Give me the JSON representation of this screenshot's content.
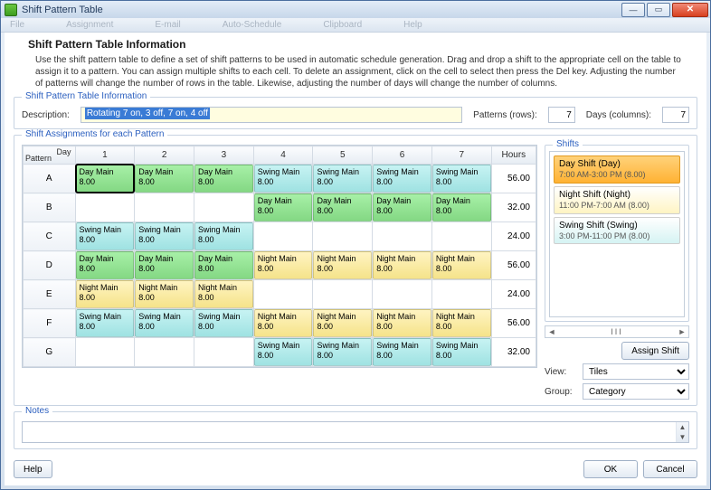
{
  "window": {
    "title": "Shift Pattern Table"
  },
  "menubar": [
    "File",
    "Assignment",
    "E-mail",
    "Auto-Schedule",
    "Clipboard",
    "Help"
  ],
  "header": {
    "title": "Shift Pattern Table Information",
    "intro": "Use the shift pattern table to define a set of shift patterns to be used in automatic schedule generation. Drag and drop a shift to the appropriate cell on the table to assign it to a pattern. You can assign multiple shifts to each cell. To delete an assignment, click on the cell to select then press the Del key.  Adjusting the number of patterns will change the number of rows in the table. Likewise, adjusting the number of days will change the number of columns."
  },
  "info": {
    "legend": "Shift Pattern Table Information",
    "descriptionLabel": "Description:",
    "description": "Rotating 7 on, 3 off, 7 on, 4 off",
    "patternsLabel": "Patterns (rows):",
    "patterns": "7",
    "daysLabel": "Days (columns):",
    "days": "7"
  },
  "assign": {
    "legend": "Shift Assignments for each Pattern",
    "cornerDay": "Day",
    "cornerPattern": "Pattern",
    "cols": [
      "1",
      "2",
      "3",
      "4",
      "5",
      "6",
      "7"
    ],
    "hoursHeader": "Hours",
    "rows": [
      "A",
      "B",
      "C",
      "D",
      "E",
      "F",
      "G"
    ],
    "shiftStrings": {
      "day": "Day Main",
      "night": "Night Main",
      "swing": "Swing Main",
      "hours": "8.00"
    },
    "cells": [
      [
        "day",
        "day",
        "day",
        "swing",
        "swing",
        "swing",
        "swing"
      ],
      [
        "",
        "",
        "",
        "day",
        "day",
        "day",
        "day"
      ],
      [
        "swing",
        "swing",
        "swing",
        "",
        "",
        "",
        ""
      ],
      [
        "day",
        "day",
        "day",
        "night",
        "night",
        "night",
        "night"
      ],
      [
        "night",
        "night",
        "night",
        "",
        "",
        "",
        ""
      ],
      [
        "swing",
        "swing",
        "swing",
        "night",
        "night",
        "night",
        "night"
      ],
      [
        "",
        "",
        "",
        "swing",
        "swing",
        "swing",
        "swing"
      ]
    ],
    "selected": {
      "row": 0,
      "col": 0
    },
    "hours": [
      "56.00",
      "32.00",
      "24.00",
      "56.00",
      "24.00",
      "56.00",
      "32.00"
    ]
  },
  "shifts": {
    "legend": "Shifts",
    "items": [
      {
        "title": "Day Shift (Day)",
        "sub": "7:00 AM-3:00 PM (8.00)",
        "cls": "day",
        "selected": true
      },
      {
        "title": "Night Shift (Night)",
        "sub": "11:00 PM-7:00 AM (8.00)",
        "cls": "night",
        "selected": false
      },
      {
        "title": "Swing Shift (Swing)",
        "sub": "3:00 PM-11:00 PM (8.00)",
        "cls": "swing",
        "selected": false
      }
    ],
    "assignButton": "Assign Shift",
    "viewLabel": "View:",
    "viewValue": "Tiles",
    "groupLabel": "Group:",
    "groupValue": "Category"
  },
  "notes": {
    "legend": "Notes"
  },
  "footer": {
    "help": "Help",
    "ok": "OK",
    "cancel": "Cancel"
  },
  "colors": {
    "day": "#84d884",
    "night": "#f5e38a",
    "swing": "#9fe2e2"
  }
}
